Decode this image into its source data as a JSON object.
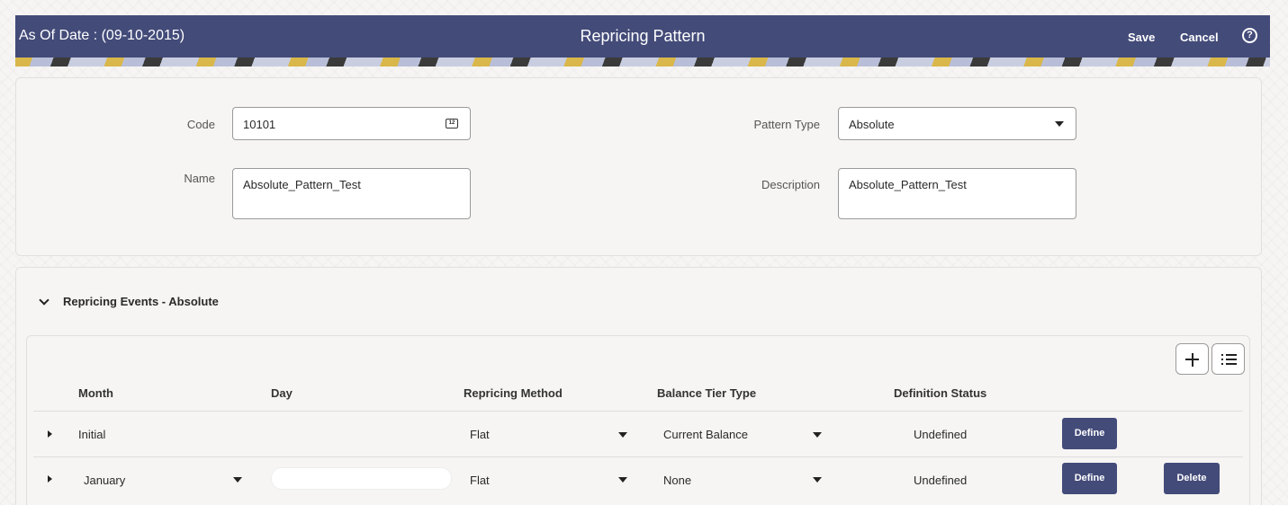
{
  "header": {
    "as_of": "As Of Date : (09-10-2015)",
    "title": "Repricing Pattern",
    "save_label": "Save",
    "cancel_label": "Cancel",
    "help_glyph": "?"
  },
  "form": {
    "code_label": "Code",
    "code_value": "10101",
    "calendar_icon_text": "12",
    "pattern_type_label": "Pattern Type",
    "pattern_type_value": "Absolute",
    "name_label": "Name",
    "name_value": "Absolute_Pattern_Test",
    "description_label": "Description",
    "description_value": "Absolute_Pattern_Test"
  },
  "events": {
    "section_title": "Repricing Events -  Absolute",
    "columns": [
      "Month",
      "Day",
      "Repricing Method",
      "Balance Tier Type",
      "Definition Status"
    ],
    "rows": [
      {
        "month": "Initial",
        "day": "",
        "repricing_method": "Flat",
        "balance_tier_type": "Current Balance",
        "definition_status": "Undefined",
        "define_label": "Define"
      },
      {
        "month": "January",
        "day": "",
        "repricing_method": "Flat",
        "balance_tier_type": "None",
        "definition_status": "Undefined",
        "define_label": "Define",
        "delete_label": "Delete"
      }
    ]
  },
  "icons": {
    "add": "plus-icon",
    "list": "list-icon",
    "help": "help-icon",
    "calendar": "calendar-icon"
  },
  "colors": {
    "header_bg": "#434b79",
    "button_bg": "#434b79"
  }
}
